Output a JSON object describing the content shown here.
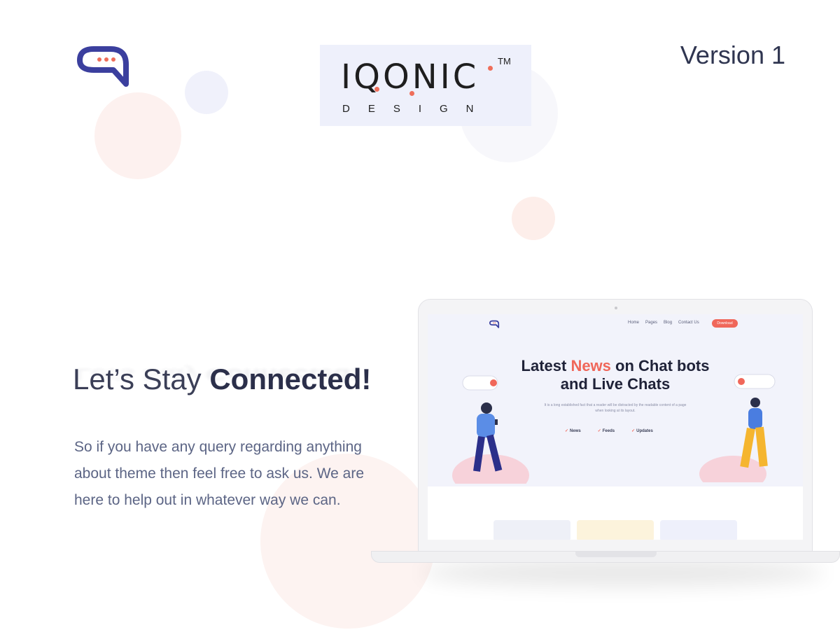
{
  "header": {
    "version_label": "Version 1"
  },
  "brand": {
    "name": "IQONIC",
    "trademark": "TM",
    "subtitle": "DESIGN"
  },
  "main": {
    "headline_light": "Let’s Stay ",
    "headline_bold": "Connected!",
    "paragraph": "So if you have any query regarding anything about theme then feel free to ask us. We are here to help out in whatever way we can."
  },
  "preview": {
    "nav": [
      "Home",
      "Pages",
      "Blog",
      "Contact Us"
    ],
    "download_label": "Download",
    "title_part1": "Latest ",
    "title_accent": "News",
    "title_part2": " on Chat bots and Live Chats",
    "description": "It is a long established fact that a reader will be distracted by the readable content of a page when looking at its layout.",
    "tags": [
      "News",
      "Feeds",
      "Updates"
    ]
  },
  "colors": {
    "accent": "#f0675a",
    "brand_navy": "#3b3f9e",
    "text_dark": "#2b2f4a",
    "text_body": "#5c6585"
  },
  "icons": {
    "app_logo": "chat-bubble-logo-icon"
  }
}
